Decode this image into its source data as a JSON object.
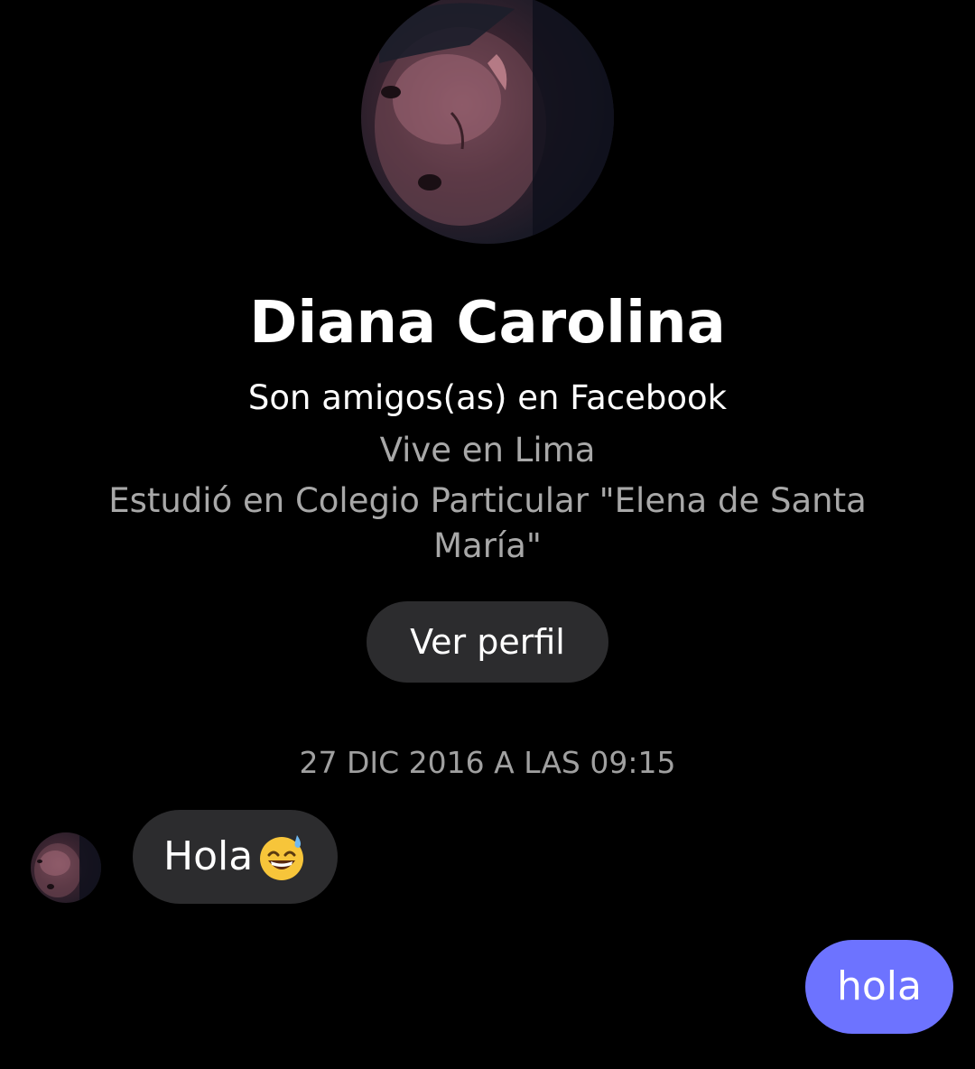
{
  "profile": {
    "name": "Diana Carolina",
    "friends_text": "Son amigos(as) en Facebook",
    "lives_in": "Vive en Lima",
    "studied_at": "Estudió en Colegio Particular \"Elena de Santa María\"",
    "view_profile_label": "Ver perfil",
    "avatar_icon": "profile-photo"
  },
  "conversation": {
    "timestamp": "27 DIC 2016 A LAS 09:15",
    "messages": [
      {
        "direction": "incoming",
        "text": "Hola",
        "emoji": "grinning-sweat-emoji"
      },
      {
        "direction": "outgoing",
        "text": "hola"
      }
    ]
  },
  "colors": {
    "background": "#000000",
    "incoming_bubble": "#2c2c2e",
    "outgoing_bubble": "#6d73ff",
    "secondary_text": "#a8a8a8"
  }
}
